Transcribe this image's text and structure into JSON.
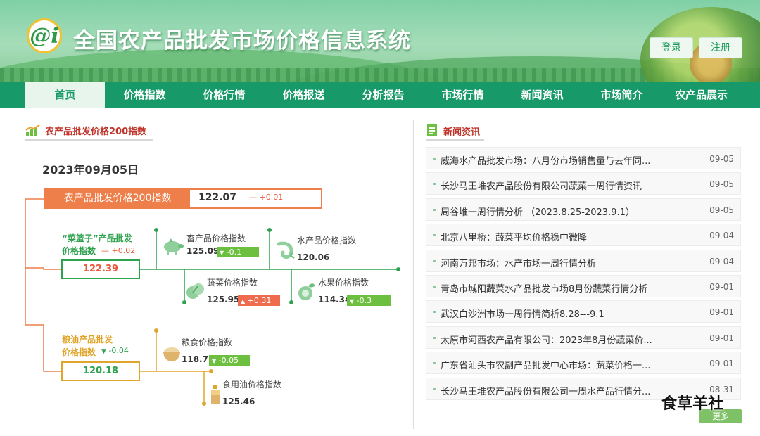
{
  "header": {
    "logo_text": "@i",
    "title": "全国农产品批发市场价格信息系统",
    "login": "登录",
    "register": "注册"
  },
  "nav": [
    "首页",
    "价格指数",
    "价格行情",
    "价格报送",
    "分析报告",
    "市场行情",
    "新闻资讯",
    "市场简介",
    "农产品展示"
  ],
  "nav_active": 0,
  "index_panel": {
    "heading": "农产品批发价格200指数",
    "date": "2023年09月05日",
    "main": {
      "label": "农产品批发价格200指数",
      "value": "122.07",
      "change": "+0.01"
    },
    "basket": {
      "label_line1": "“菜篮子”产品批发",
      "label_line2": "价格指数",
      "change": "+0.02",
      "value": "122.39"
    },
    "grain": {
      "label_line1": "粮油产品批发",
      "label_line2": "价格指数",
      "change": "-0.04",
      "value": "120.18"
    },
    "items": {
      "livestock": {
        "name": "畜产品价格指数",
        "value": "125.09",
        "change": "-0.1",
        "direction": "down",
        "icon": "pig-icon"
      },
      "aquatic": {
        "name": "水产品价格指数",
        "value": "120.06",
        "change": "",
        "direction": "none",
        "icon": "shrimp-icon"
      },
      "vegetable": {
        "name": "蔬菜价格指数",
        "value": "125.95",
        "change": "+0.31",
        "direction": "up",
        "icon": "vegetable-icon"
      },
      "fruit": {
        "name": "水果价格指数",
        "value": "114.34",
        "change": "-0.3",
        "direction": "down",
        "icon": "fruit-icon"
      },
      "grain": {
        "name": "粮食价格指数",
        "value": "118.71",
        "change": "-0.05",
        "direction": "down",
        "icon": "grain-bowl-icon"
      },
      "oil": {
        "name": "食用油价格指数",
        "value": "125.46",
        "change": "",
        "direction": "none",
        "icon": "oil-bottle-icon"
      }
    },
    "colors": {
      "orange": "#ee7f4b",
      "green": "#2fa24f",
      "gold": "#e0a52a",
      "red": "#e85a3b",
      "down_green": "#6cbf3f"
    }
  },
  "news": {
    "heading": "新闻资讯",
    "items": [
      {
        "title": "威海水产品批发市场：八月份市场销售量与去年同...",
        "date": "09-05"
      },
      {
        "title": "长沙马王堆农产品股份有限公司蔬菜一周行情资讯",
        "date": "09-05"
      },
      {
        "title": "周谷堆一周行情分析 （2023.8.25-2023.9.1）",
        "date": "09-05"
      },
      {
        "title": "北京八里桥：蔬菜平均价格稳中微降",
        "date": "09-04"
      },
      {
        "title": "河南万邦市场：水产市场一周行情分析",
        "date": "09-04"
      },
      {
        "title": "青岛市城阳蔬菜水产品批发市场8月份蔬菜行情分析",
        "date": "09-01"
      },
      {
        "title": "武汉白沙洲市场一周行情简析8.28---9.1",
        "date": "09-01"
      },
      {
        "title": "太原市河西农产品有限公司：2023年8月份蔬菜价...",
        "date": "09-01"
      },
      {
        "title": "广东省汕头市农副产品批发中心市场：蔬菜价格一...",
        "date": "09-01"
      },
      {
        "title": "长沙马王堆农产品股份有限公司一周水产品行情分...",
        "date": "08-31"
      }
    ],
    "more": "更多"
  },
  "watermark": "食草羊社"
}
